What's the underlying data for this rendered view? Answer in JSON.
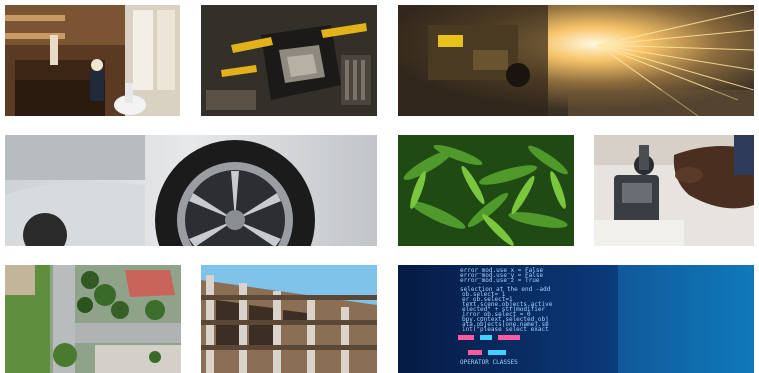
{
  "gallery": {
    "tiles": [
      {
        "icon": "cafe-photo-icon"
      },
      {
        "icon": "circuit-board-photo-icon"
      },
      {
        "icon": "metal-grinding-sparks-photo-icon"
      },
      {
        "icon": "car-wheel-photo-icon"
      },
      {
        "icon": "cannabis-plants-photo-icon"
      },
      {
        "icon": "microscope-photo-icon"
      },
      {
        "icon": "aerial-neighborhood-photo-icon"
      },
      {
        "icon": "building-construction-photo-icon"
      },
      {
        "icon": "source-code-screen-photo-icon"
      }
    ]
  },
  "code_screen": {
    "lines": [
      "error_mod.use_x = False",
      "error_mod.use_y = False",
      "error_mod.use_z = True",
      "selection at the end -add",
      "ob.select= 1",
      "er_ob.select=1",
      "text.scene.objects.active",
      "elected\" + str(modifier",
      "irror_ob.select = 0",
      "bpy.context.selected_obj",
      "ata.objects[one.name].se",
      "int(\"please select exact",
      "OPERATOR CLASSES"
    ]
  },
  "colors": {
    "background": "#ffffff",
    "code_text": "#9fd0ff",
    "code_highlight": "#ff5aa0"
  }
}
